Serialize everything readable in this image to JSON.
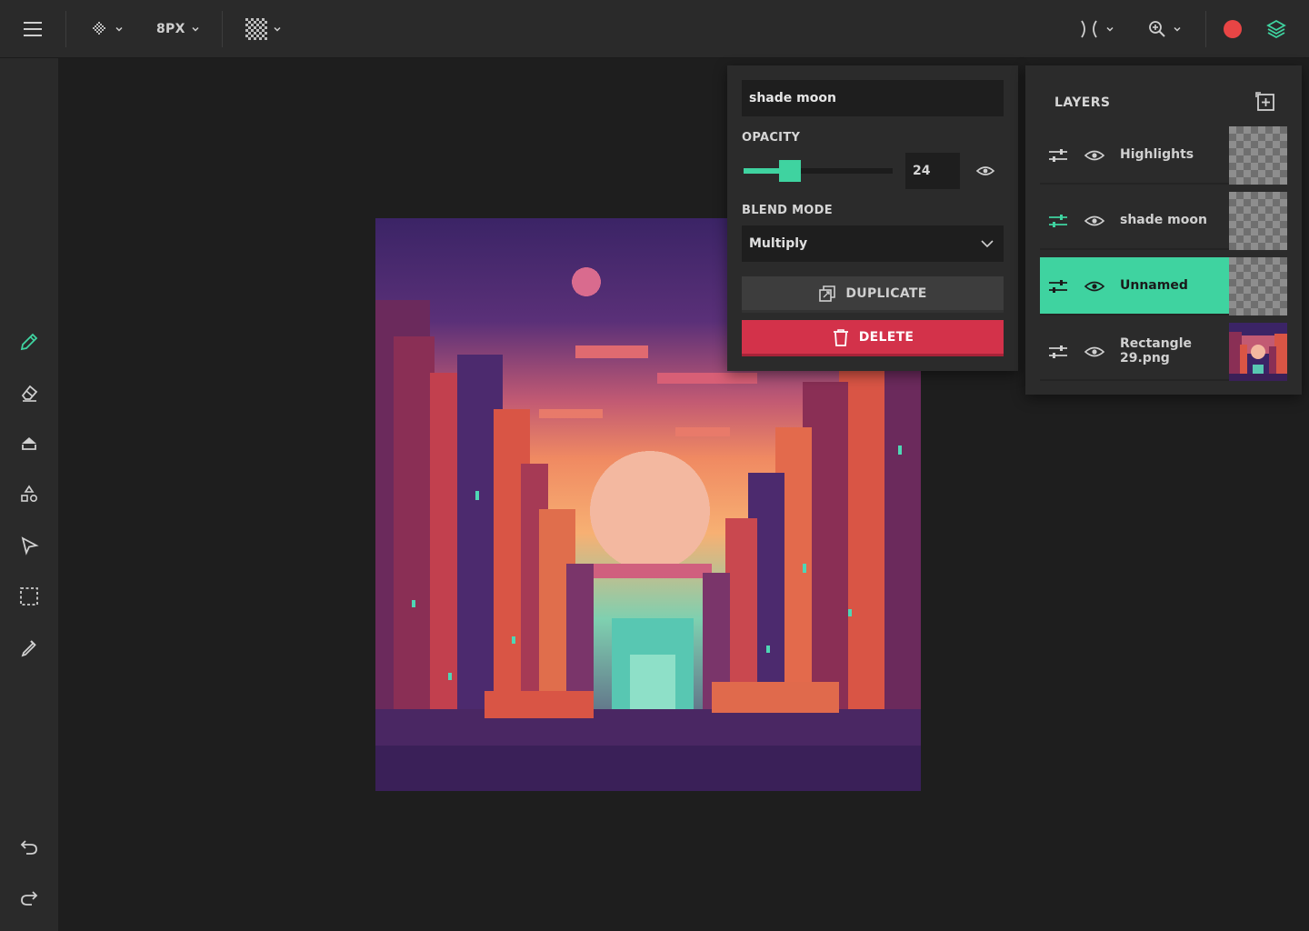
{
  "topbar": {
    "brush_size_label": "8PX"
  },
  "properties": {
    "layer_name": "shade moon",
    "opacity_label": "OPACITY",
    "opacity_value": "24",
    "opacity_fraction": 0.24,
    "blend_mode_label": "BLEND MODE",
    "blend_mode_value": "Multiply",
    "duplicate_label": "DUPLICATE",
    "delete_label": "DELETE"
  },
  "layers": {
    "title": "LAYERS",
    "items": [
      {
        "name": "Highlights",
        "active": false
      },
      {
        "name": "shade moon",
        "active": false
      },
      {
        "name": "Unnamed",
        "active": true
      },
      {
        "name": "Rectangle 29.png",
        "active": false
      }
    ]
  },
  "colors": {
    "accent": "#3fd3a0",
    "danger": "#d3324a",
    "record": "#e84545",
    "panel": "#2b2b2b",
    "background": "#1e1e1e"
  },
  "icons": {
    "menu": "hamburger-icon",
    "dither": "dither-pattern-icon",
    "pattern": "checker-pattern-icon",
    "symmetry": "mirror-icon",
    "zoom": "zoom-in-icon",
    "layers": "layers-icon"
  }
}
